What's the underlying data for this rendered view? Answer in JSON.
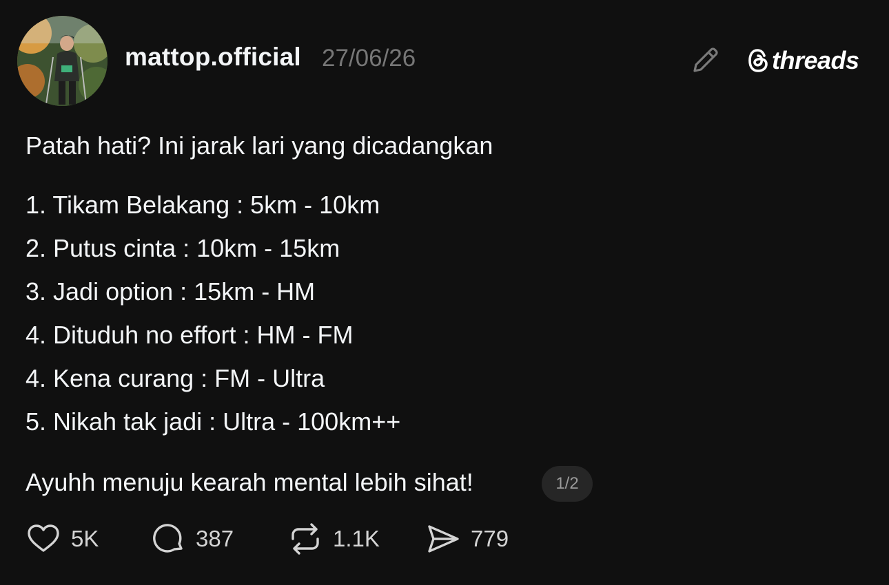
{
  "header": {
    "username": "mattop.official",
    "date": "27/06/26",
    "brand": "threads",
    "avatar_icon": "profile-photo-hiker",
    "edit_icon": "pencil-icon"
  },
  "post": {
    "intro": "Patah hati? Ini jarak lari yang dicadangkan",
    "items": [
      "1. Tikam Belakang : 5km - 10km",
      "2. Putus cinta : 10km - 15km",
      "3. Jadi option : 15km - HM",
      "4. Dituduh no effort : HM - FM",
      "4. Kena curang : FM - Ultra",
      "5. Nikah tak jadi : Ultra - 100km++"
    ],
    "closing": "Ayuhh menuju kearah mental lebih sihat!",
    "page_indicator": "1/2"
  },
  "actions": {
    "like": {
      "icon": "heart-icon",
      "count": "5K"
    },
    "reply": {
      "icon": "comment-icon",
      "count": "387"
    },
    "repost": {
      "icon": "repost-icon",
      "count": "1.1K"
    },
    "share": {
      "icon": "send-icon",
      "count": "779"
    }
  },
  "colors": {
    "background": "#101010",
    "text": "#f3f5f7",
    "muted": "#777777",
    "badge_bg": "#262626"
  }
}
